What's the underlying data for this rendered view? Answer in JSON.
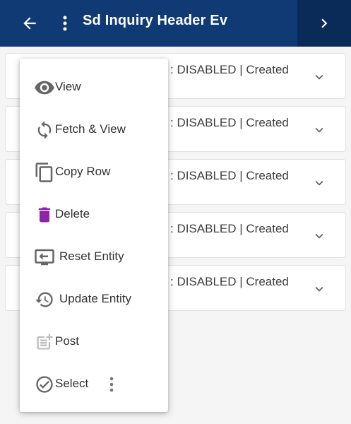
{
  "header": {
    "title": "Sd Inquiry Header Ev",
    "colors": {
      "bar": "#0f3a73",
      "next_bg": "#0a2b57"
    }
  },
  "cards": [
    {
      "status": ": DISABLED | Created"
    },
    {
      "status": ": DISABLED | Created"
    },
    {
      "status": ": DISABLED | Created"
    },
    {
      "status": ": DISABLED | Created"
    },
    {
      "status": ": DISABLED | Created"
    }
  ],
  "menu": {
    "items": [
      {
        "label": "View",
        "icon": "eye-icon"
      },
      {
        "label": "Fetch & View",
        "icon": "refresh-icon"
      },
      {
        "label": "Copy Row",
        "icon": "copy-icon"
      },
      {
        "label": "Delete",
        "icon": "trash-icon"
      },
      {
        "label": "Reset Entity",
        "icon": "reset-icon"
      },
      {
        "label": "Update Entity",
        "icon": "history-icon"
      },
      {
        "label": "Post",
        "icon": "post-icon"
      },
      {
        "label": "Select",
        "icon": "check-circle-icon"
      }
    ],
    "delete_color": "#8e24aa"
  }
}
